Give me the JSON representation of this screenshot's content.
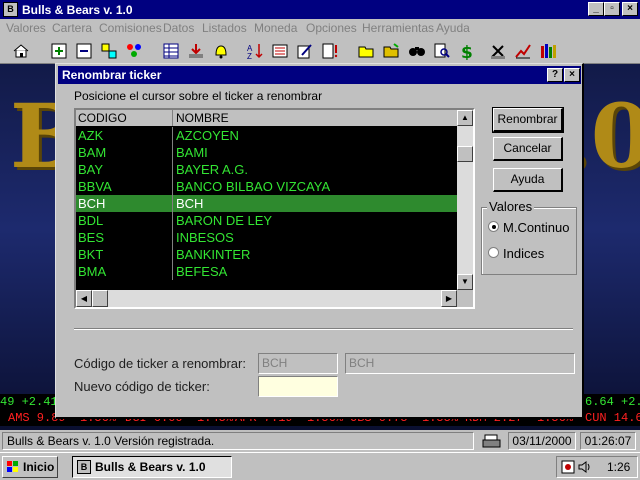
{
  "app": {
    "title": "Bulls & Bears v. 1.0",
    "menu": [
      "Valores",
      "Cartera",
      "Comisiones",
      "Datos",
      "Listados",
      "Moneda",
      "Opciones",
      "Herramientas",
      "Ayuda"
    ]
  },
  "background": {
    "left_letter": "B",
    "right_text": ".0",
    "ticker_top": [
      "49 +2.41%",
      "6.64 +2.1"
    ],
    "ticker_bottom": [
      "AMS 9.89 -1.56%",
      "DGI 6.00 -1.45%",
      "APR 7.19 -1.56%",
      "OBS 0.75 -1.55%",
      "RDM 2.27 -1.56%",
      "CUN 14.6"
    ]
  },
  "dialog": {
    "title": "Renombrar ticker",
    "instruction": "Posicione el cursor sobre el ticker a renombrar",
    "columns": [
      "CODIGO",
      "NOMBRE"
    ],
    "rows": [
      {
        "code": "AZK",
        "name": "AZCOYEN"
      },
      {
        "code": "BAM",
        "name": "BAMI"
      },
      {
        "code": "BAY",
        "name": "BAYER A.G."
      },
      {
        "code": "BBVA",
        "name": "BANCO BILBAO VIZCAYA"
      },
      {
        "code": "BCH",
        "name": "BCH"
      },
      {
        "code": "BDL",
        "name": "BARON DE LEY"
      },
      {
        "code": "BES",
        "name": "INBESOS"
      },
      {
        "code": "BKT",
        "name": "BANKINTER"
      },
      {
        "code": "BMA",
        "name": "BEFESA"
      }
    ],
    "selected_index": 4,
    "buttons": {
      "rename": "Renombrar",
      "cancel": "Cancelar",
      "help": "Ayuda"
    },
    "group": {
      "label": "Valores",
      "options": [
        "M.Continuo",
        "Indices"
      ],
      "selected": 0
    },
    "form": {
      "ticker_label": "Código de ticker a renombrar:",
      "ticker_code": "BCH",
      "ticker_name": "BCH",
      "new_label": "Nuevo código de ticker:",
      "new_value": ""
    }
  },
  "statusbar": {
    "message": "Bulls & Bears v. 1.0  Versión registrada.",
    "date": "03/11/2000",
    "time": "01:26:07"
  },
  "taskbar": {
    "start": "Inicio",
    "task": "Bulls & Bears v. 1.0",
    "clock": "1:26"
  },
  "colors": {
    "titlebar": "#000080",
    "grid_text": "#33e533",
    "grid_selected": "#2e8a2e",
    "ticker_up": "#33e533",
    "ticker_down": "#ff2020"
  }
}
